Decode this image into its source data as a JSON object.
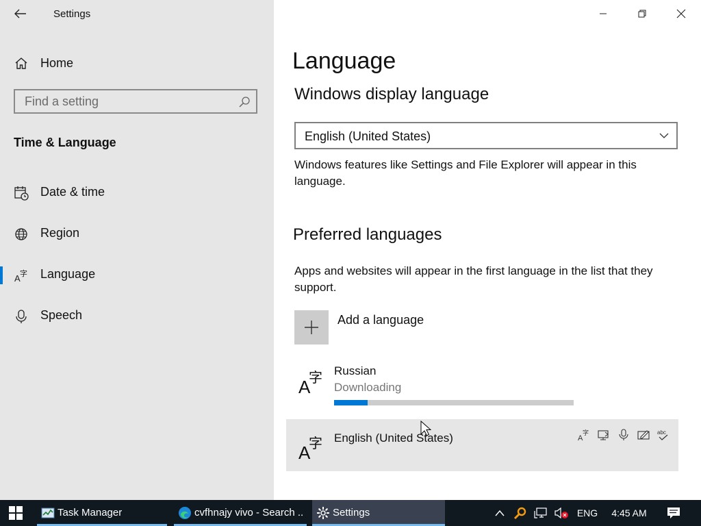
{
  "window": {
    "app_title": "Settings",
    "controls": {
      "minimize": "minimize",
      "maximize": "restore",
      "close": "close"
    }
  },
  "sidebar": {
    "home_label": "Home",
    "search_placeholder": "Find a setting",
    "section_heading": "Time & Language",
    "items": [
      {
        "label": "Date & time",
        "icon": "calendar-clock-icon",
        "selected": false
      },
      {
        "label": "Region",
        "icon": "globe-icon",
        "selected": false
      },
      {
        "label": "Language",
        "icon": "language-icon",
        "selected": true
      },
      {
        "label": "Speech",
        "icon": "microphone-icon",
        "selected": false
      }
    ]
  },
  "main": {
    "page_title": "Language",
    "display_language": {
      "heading": "Windows display language",
      "selected_value": "English (United States)",
      "description": "Windows features like Settings and File Explorer will appear in this language."
    },
    "preferred": {
      "heading": "Preferred languages",
      "description": "Apps and websites will appear in the first language in the list that they support.",
      "add_label": "Add a language",
      "languages": [
        {
          "name": "Russian",
          "status": "Downloading",
          "progress": 0.14
        },
        {
          "name": "English (United States)",
          "features": [
            "display-language-icon",
            "speech-icon",
            "microphone-icon",
            "handwriting-icon",
            "spellcheck-icon"
          ]
        }
      ]
    }
  },
  "taskbar": {
    "apps": [
      {
        "label": "Task Manager",
        "icon": "task-manager-icon"
      },
      {
        "label": "cvfhnajy vivo - Search ...",
        "icon": "edge-icon"
      },
      {
        "label": "Settings",
        "icon": "gear-icon",
        "active": true
      }
    ],
    "tray": {
      "language": "ENG",
      "time": "4:45 AM"
    }
  },
  "colors": {
    "accent": "#0078d4",
    "sidebar_bg": "#e6e6e6",
    "taskbar_bg": "#101820"
  }
}
